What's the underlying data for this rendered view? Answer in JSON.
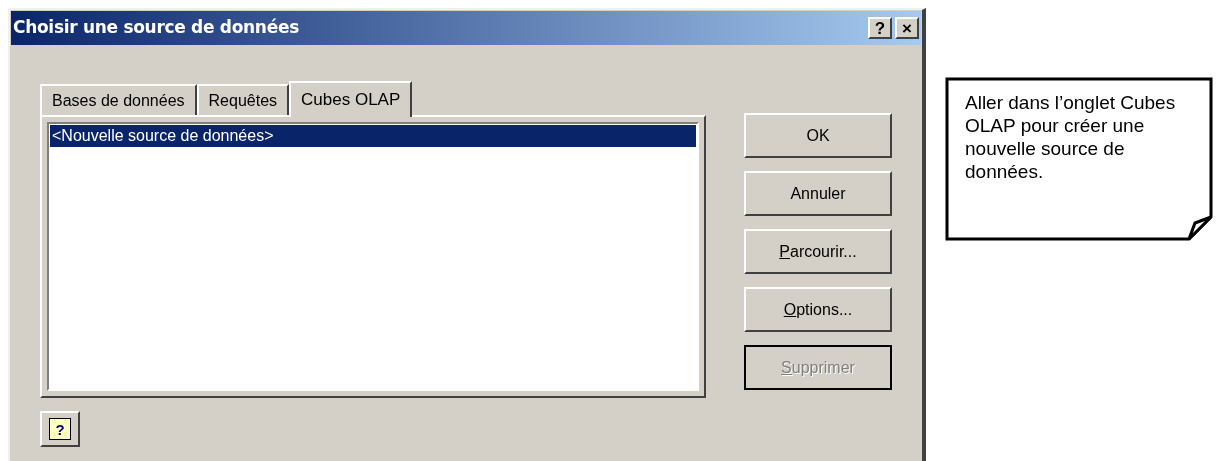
{
  "window": {
    "title": "Choisir une source de données",
    "title_buttons": [
      "?",
      "×"
    ]
  },
  "tabs": [
    {
      "label": "Bases de données",
      "selected": false
    },
    {
      "label": "Requêtes",
      "selected": false
    },
    {
      "label": "Cubes OLAP",
      "selected": true
    }
  ],
  "list": {
    "items": [
      {
        "label": "<Nouvelle source de données>",
        "selected": true
      }
    ]
  },
  "buttons": [
    {
      "label": "OK",
      "mnemonic_first": false,
      "disabled": false,
      "focused": false
    },
    {
      "label": "Annuler",
      "mnemonic_first": false,
      "disabled": false,
      "focused": false
    },
    {
      "label": "Parcourir...",
      "mnemonic_first": true,
      "disabled": false,
      "focused": false
    },
    {
      "label": "Options...",
      "mnemonic_first": true,
      "disabled": false,
      "focused": false
    },
    {
      "label": "Supprimer",
      "mnemonic_first": true,
      "disabled": true,
      "focused": true
    }
  ],
  "help_button": {
    "glyph": "?"
  },
  "callout": {
    "text": "Aller dans l’onglet Cubes OLAP pour créer une nouvelle source de données."
  }
}
